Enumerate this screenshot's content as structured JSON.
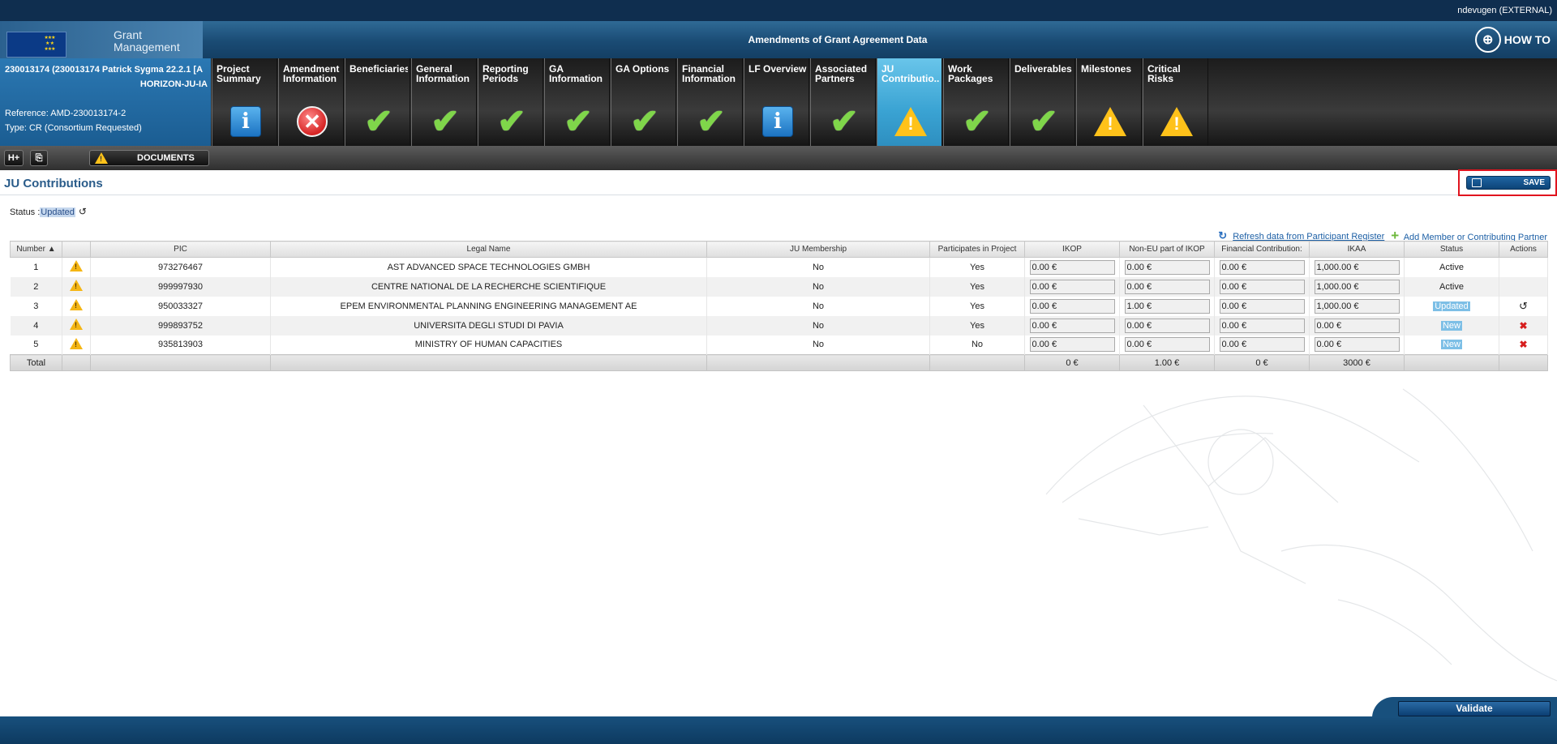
{
  "topbar": {
    "user": "ndevugen (EXTERNAL)"
  },
  "header": {
    "logo_line1": "Grant",
    "logo_line2": "Management",
    "title": "Amendments of Grant Agreement Data",
    "howto_label": "HOW TO"
  },
  "project": {
    "line1": "230013174 (230013174 Patrick Sygma 22.2.1 [A",
    "line2": "HORIZON-JU-IA",
    "reference": "Reference: AMD-230013174-2",
    "type": "Type: CR (Consortium Requested)"
  },
  "tabs": [
    {
      "label": "Project Summary",
      "icon": "info"
    },
    {
      "label": "Amendment Information",
      "icon": "error"
    },
    {
      "label": "Beneficiaries",
      "icon": "check"
    },
    {
      "label": "General Information",
      "icon": "check"
    },
    {
      "label": "Reporting Periods",
      "icon": "check"
    },
    {
      "label": "GA Information",
      "icon": "check"
    },
    {
      "label": "GA Options",
      "icon": "check"
    },
    {
      "label": "Financial Information",
      "icon": "check"
    },
    {
      "label": "LF Overview",
      "icon": "info"
    },
    {
      "label": "Associated Partners",
      "icon": "check"
    },
    {
      "label": "JU Contributio...",
      "icon": "warning",
      "active": true
    },
    {
      "label": "Work Packages",
      "icon": "check"
    },
    {
      "label": "Deliverables",
      "icon": "check"
    },
    {
      "label": "Milestones",
      "icon": "warning"
    },
    {
      "label": "Critical Risks",
      "icon": "warning"
    }
  ],
  "toolbar": {
    "btn1": "H+",
    "btn2": "⎘",
    "documents": "DOCUMENTS"
  },
  "page": {
    "title": "JU Contributions",
    "save": "SAVE",
    "status_label": "Status :",
    "status_value": "Updated",
    "refresh_link": "Refresh data from Participant Register",
    "add_link": "Add Member or Contributing Partner",
    "validate": "Validate"
  },
  "table": {
    "headers": {
      "number": "Number ▲",
      "warn": "",
      "pic": "PIC",
      "legal_name": "Legal Name",
      "ju_membership": "JU Membership",
      "participates": "Participates in Project",
      "ikop": "IKOP",
      "non_eu": "Non-EU part of IKOP",
      "financial": "Financial Contribution:",
      "ikaa": "IKAA",
      "status": "Status",
      "actions": "Actions"
    },
    "rows": [
      {
        "number": "1",
        "pic": "973276467",
        "legal_name": "AST ADVANCED SPACE TECHNOLOGIES GMBH",
        "ju_membership": "No",
        "participates": "Yes",
        "ikop": "0.00 €",
        "non_eu": "0.00 €",
        "financial": "0.00 €",
        "ikaa": "1,000.00 €",
        "status": "Active",
        "action": ""
      },
      {
        "number": "2",
        "pic": "999997930",
        "legal_name": "CENTRE NATIONAL DE LA RECHERCHE SCIENTIFIQUE",
        "ju_membership": "No",
        "participates": "Yes",
        "ikop": "0.00 €",
        "non_eu": "0.00 €",
        "financial": "0.00 €",
        "ikaa": "1,000.00 €",
        "status": "Active",
        "action": ""
      },
      {
        "number": "3",
        "pic": "950033327",
        "legal_name": "EPEM ENVIRONMENTAL PLANNING ENGINEERING MANAGEMENT AE",
        "ju_membership": "No",
        "participates": "Yes",
        "ikop": "0.00 €",
        "non_eu": "1.00 €",
        "financial": "0.00 €",
        "ikaa": "1,000.00 €",
        "status": "Updated",
        "action": "undo"
      },
      {
        "number": "4",
        "pic": "999893752",
        "legal_name": "UNIVERSITA DEGLI STUDI DI PAVIA",
        "ju_membership": "No",
        "participates": "Yes",
        "ikop": "0.00 €",
        "non_eu": "0.00 €",
        "financial": "0.00 €",
        "ikaa": "0.00 €",
        "status": "New",
        "action": "delete"
      },
      {
        "number": "5",
        "pic": "935813903",
        "legal_name": "MINISTRY OF HUMAN CAPACITIES",
        "ju_membership": "No",
        "participates": "No",
        "ikop": "0.00 €",
        "non_eu": "0.00 €",
        "financial": "0.00 €",
        "ikaa": "0.00 €",
        "status": "New",
        "action": "delete"
      }
    ],
    "totals": {
      "label": "Total",
      "ikop": "0 €",
      "non_eu": "1.00 €",
      "financial": "0 €",
      "ikaa": "3000 €"
    }
  },
  "colors": {
    "accent": "#1b5d92",
    "active_tab": "#3aa3d3",
    "save_border": "#e0141e",
    "check": "#7fd64a",
    "warning": "#ffc21a"
  }
}
